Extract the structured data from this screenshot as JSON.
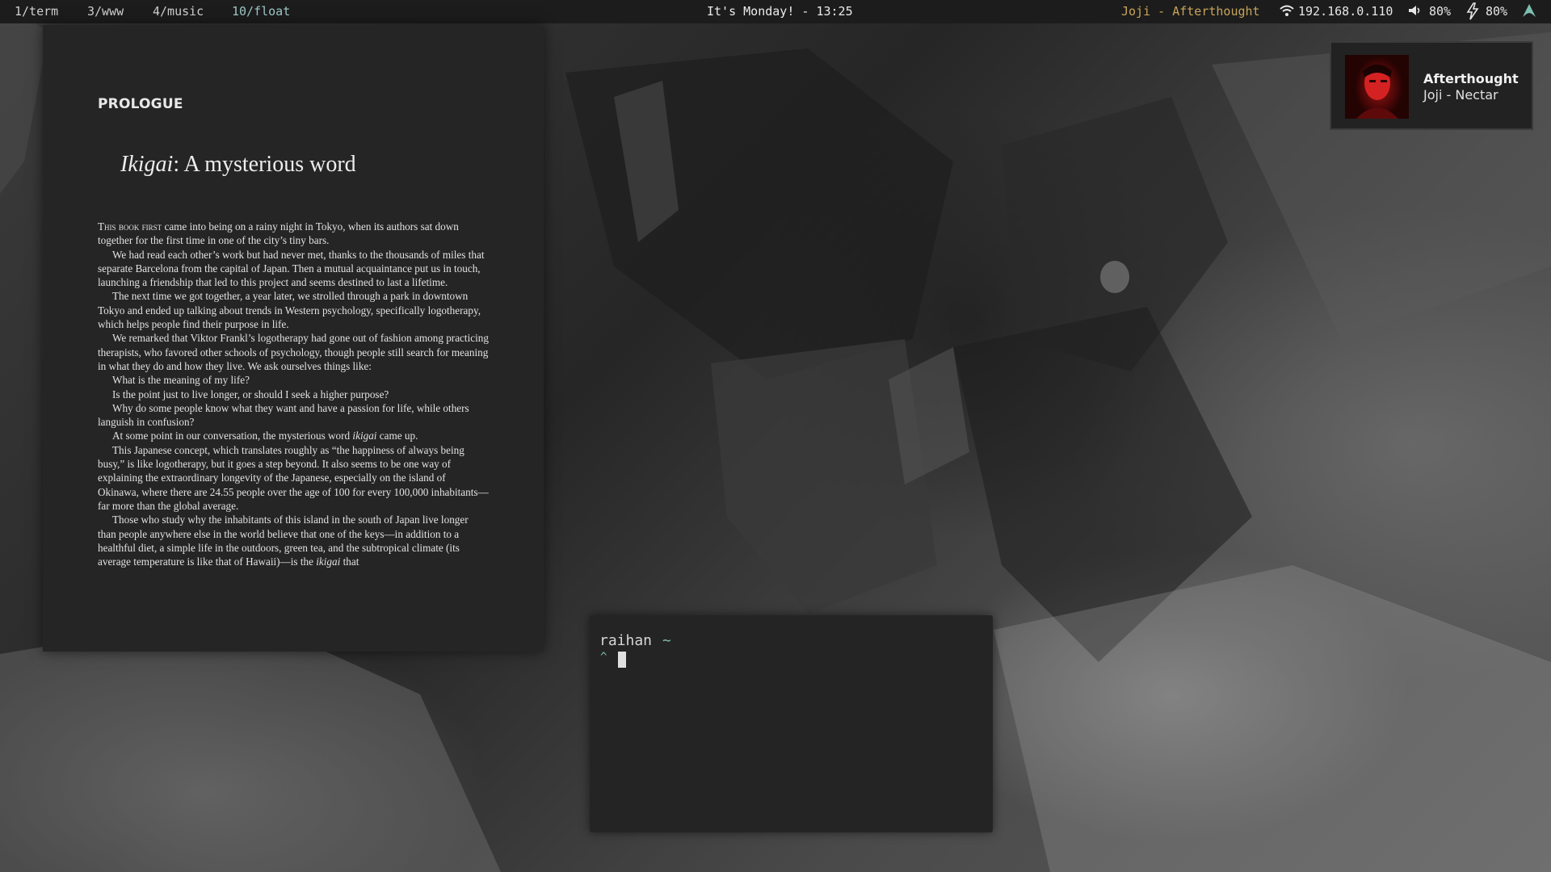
{
  "topbar": {
    "workspaces": [
      {
        "label": "1/term"
      },
      {
        "label": "3/www"
      },
      {
        "label": "4/music"
      },
      {
        "label": "10/float"
      }
    ],
    "clock": "It's Monday! - 13:25",
    "now_playing": "Joji - Afterthought",
    "ip": "192.168.0.110",
    "volume": "80%",
    "battery": "80%",
    "icons": [
      "wifi-icon",
      "volume-icon",
      "battery-icon",
      "arch-logo-icon"
    ]
  },
  "reader": {
    "section": "PROLOGUE",
    "title_italic": "Ikigai",
    "title_rest": ": A mysterious word",
    "p1_lead": "This book first",
    "p1_rest": " came into being on a rainy night in Tokyo, when its authors sat down together for the first time in one of the city’s tiny bars.",
    "p2": "We had read each other’s work but had never met, thanks to the thousands of miles that separate Barcelona from the capital of Japan. Then a mutual acquaintance put us in touch, launching a friendship that led to this project and seems destined to last a lifetime.",
    "p3": "The next time we got together, a year later, we strolled through a park in downtown Tokyo and ended up talking about trends in Western psychology, specifically logotherapy, which helps people find their purpose in life.",
    "p4": "We remarked that Viktor Frankl’s logotherapy had gone out of fashion among practicing therapists, who favored other schools of psychology, though people still search for meaning in what they do and how they live. We ask ourselves things like:",
    "p5": "What is the meaning of my life?",
    "p6": "Is the point just to live longer, or should I seek a higher purpose?",
    "p7": "Why do some people know what they want and have a passion for life, while others languish in confusion?",
    "p8_a": "At some point in our conversation, the mysterious word ",
    "p8_ital": "ikigai",
    "p8_b": " came up.",
    "p9": "This Japanese concept, which translates roughly as “the happiness of always being busy,” is like logotherapy, but it goes a step beyond. It also seems to be one way of explaining the extraordinary longevity of the Japanese, especially on the island of Okinawa, where there are 24.55 people over the age of 100 for every 100,000 inhabitants—far more than the global average.",
    "p10_a": "Those who study why the inhabitants of this island in the south of Japan live longer than people anywhere else in the world believe that one of the keys—in addition to a healthful diet, a simple life in the outdoors, green tea, and the subtropical climate (its average temperature is like that of Hawaii)—is the ",
    "p10_ital": "ikigai",
    "p10_b": " that"
  },
  "terminal": {
    "user": "raihan",
    "cwd": "~",
    "prompt": "^"
  },
  "now_playing_card": {
    "title": "Afterthought",
    "artist_album": "Joji - Nectar"
  },
  "colors": {
    "bar_bg": "#1c1c1c",
    "accent_gold": "#c8a45a",
    "accent_teal": "#7bbfb0",
    "window_bg": "#252525"
  }
}
